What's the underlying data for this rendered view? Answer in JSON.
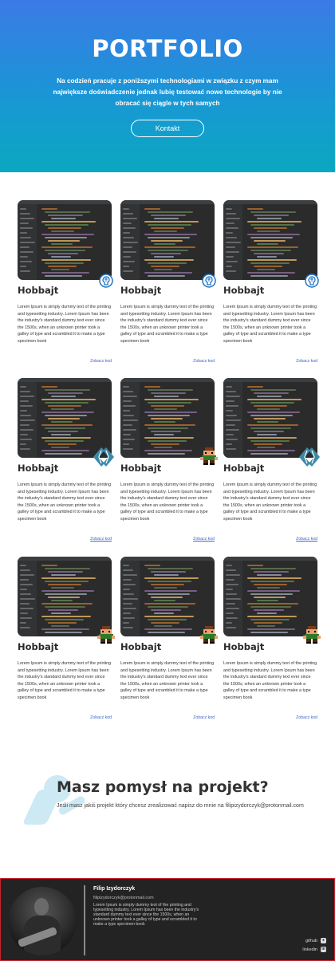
{
  "hero": {
    "title": "PORTFOLIO",
    "subtitle": "Na codzień pracuje z poniższymi technologiami w związku z czym mam największe doświadczenie jednak lubię testować nowe technologie by nie obracać się ciągle w tych samych",
    "button_label": "Kontakt"
  },
  "projects": [
    {
      "title": "Hobbajt",
      "description": "Lorem Ipsum is simply dummy text of the printing and typesetting industry. Lorem Ipsum has been the industry's standard dummy text ever since the 1500s, when an unknown printer took a galley of type and scrambled it to make a type specimen book",
      "link": "Zobacz kod",
      "icon": "brain-icon"
    },
    {
      "title": "Hobbajt",
      "description": "Lorem Ipsum is simply dummy text of the printing and typesetting industry. Lorem Ipsum has been the industry's standard dummy text ever since the 1500s, when an unknown printer took a galley of type and scrambled it to make a type specimen book",
      "link": "Zobacz kod",
      "icon": "brain-icon"
    },
    {
      "title": "Hobbajt",
      "description": "Lorem Ipsum is simply dummy text of the printing and typesetting industry. Lorem Ipsum has been the industry's standard dummy text ever since the 1500s, when an unknown printer took a galley of type and scrambled it to make a type specimen book",
      "link": "Zobacz kod",
      "icon": "brain-icon"
    },
    {
      "title": "Hobbajt",
      "description": "Lorem Ipsum is simply dummy text of the printing and typesetting industry. Lorem Ipsum has been the industry's standard dummy text ever since the 1500s, when an unknown printer took a galley of type and scrambled it to make a type specimen book",
      "link": "Zobacz kod",
      "icon": "code-brackets-icon"
    },
    {
      "title": "Hobbajt",
      "description": "Lorem Ipsum is simply dummy text of the printing and typesetting industry. Lorem Ipsum has been the industry's standard dummy text ever since the 1500s, when an unknown printer took a galley of type and scrambled it to make a type specimen book",
      "link": "Zobacz kod",
      "icon": "pixel-character-icon"
    },
    {
      "title": "Hobbajt",
      "description": "Lorem Ipsum is simply dummy text of the printing and typesetting industry. Lorem Ipsum has been the industry's standard dummy text ever since the 1500s, when an unknown printer took a galley of type and scrambled it to make a type specimen book",
      "link": "Zobacz kod",
      "icon": "code-brackets-icon"
    },
    {
      "title": "Hobbajt",
      "description": "Lorem Ipsum is simply dummy text of the printing and typesetting industry. Lorem Ipsum has been the industry's standard dummy text ever since the 1500s, when an unknown printer took a galley of type and scrambled it to make a type specimen book",
      "link": "Zobacz kod",
      "icon": "pixel-character-icon"
    },
    {
      "title": "Hobbajt",
      "description": "Lorem Ipsum is simply dummy text of the printing and typesetting industry. Lorem Ipsum has been the industry's standard dummy text ever since the 1500s, when an unknown printer took a galley of type and scrambled it to make a type specimen book",
      "link": "Zobacz kod",
      "icon": "pixel-character-icon"
    },
    {
      "title": "Hobbajt",
      "description": "Lorem Ipsum is simply dummy text of the printing and typesetting industry. Lorem Ipsum has been the industry's standard dummy text ever since the 1500s, when an unknown printer took a galley of type and scrambled it to make a type specimen book",
      "link": "Zobacz kod",
      "icon": "pixel-character-icon"
    }
  ],
  "cta": {
    "title": "Masz pomysł na projekt?",
    "text": "Jeśli masz jakiś projekt który chcesz zrealizować napisz do mnie na filipizydorczyk@protonmail.com"
  },
  "footer": {
    "name": "Filip Izydorczyk",
    "email": "filipizydorczyk@protonmail.com",
    "bio": "Lorem Ipsum is simply dummy text of the printing and typesetting industry. Lorem Ipsum has been the industry's standard dummy text ever since the 1500s, when an unknown printer took a galley of type and scrambled it to make a type specimen book",
    "github_label": "github",
    "linkedin_label": "linkedin"
  },
  "colors": {
    "hero_top": "#3b7ae6",
    "hero_bottom": "#0aa8c0",
    "link": "#3a64c8",
    "footer_bg": "#232323",
    "footer_border": "#c8232c",
    "badge_blue": "#1f73c4",
    "badge_teal": "#3d8aa8"
  }
}
